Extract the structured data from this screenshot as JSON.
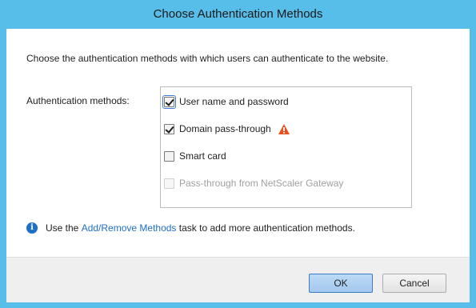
{
  "window": {
    "title": "Choose Authentication Methods"
  },
  "intro_text": "Choose the authentication methods with which users can authenticate to the website.",
  "methods_label": "Authentication methods:",
  "methods": [
    {
      "label": "User name and password",
      "checked": true,
      "enabled": true,
      "focused": true
    },
    {
      "label": "Domain pass-through",
      "checked": true,
      "enabled": true,
      "warning": true
    },
    {
      "label": "Smart card",
      "checked": false,
      "enabled": true
    },
    {
      "label": "Pass-through from NetScaler Gateway",
      "checked": false,
      "enabled": false
    }
  ],
  "info": {
    "prefix": "Use the",
    "link": "Add/Remove Methods",
    "suffix": "task to add more authentication methods."
  },
  "buttons": {
    "ok": "OK",
    "cancel": "Cancel"
  },
  "colors": {
    "frame": "#57bde9",
    "link": "#1e6fc8",
    "warning": "#e8501e",
    "info": "#1e6fc8"
  },
  "icons": {
    "warning": "warning-triangle-icon",
    "info": "info-icon"
  }
}
